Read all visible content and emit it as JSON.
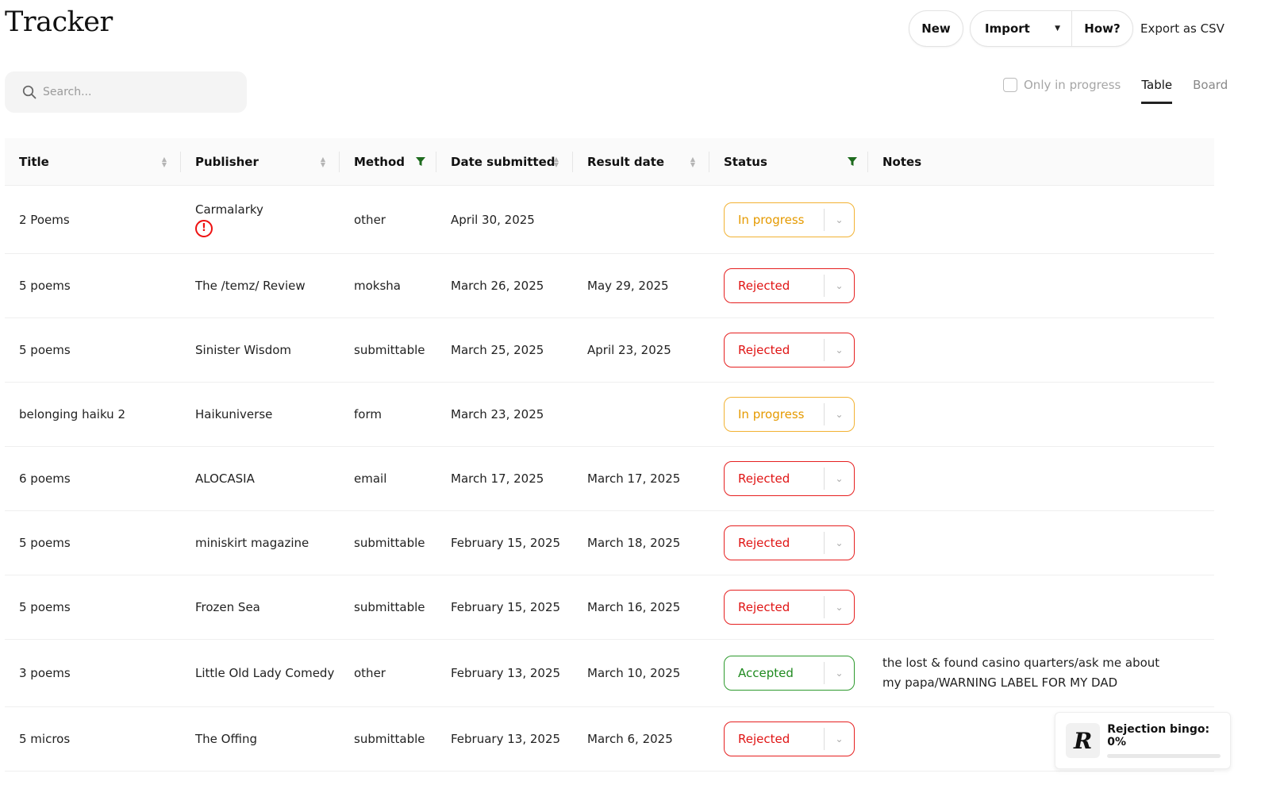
{
  "header": {
    "title": "Tracker"
  },
  "toolbar": {
    "new_label": "New",
    "import_label": "Import",
    "how_label": "How?",
    "export_label": "Export as CSV"
  },
  "search": {
    "placeholder": "Search...",
    "value": ""
  },
  "view": {
    "only_in_progress_label": "Only in progress",
    "only_in_progress_checked": false,
    "tabs": [
      "Table",
      "Board"
    ],
    "active_tab": "Table"
  },
  "table": {
    "columns": [
      "Title",
      "Publisher",
      "Method",
      "Date submitted",
      "Result date",
      "Status",
      "Notes"
    ],
    "rows": [
      {
        "title": "2 Poems",
        "publisher": "Carmalarky",
        "warning": "!",
        "method": "other",
        "date_submitted": "April 30, 2025",
        "result_date": "",
        "status": "In progress",
        "notes": ""
      },
      {
        "title": "5 poems",
        "publisher": "The /temz/ Review",
        "method": "moksha",
        "date_submitted": "March 26, 2025",
        "result_date": "May 29, 2025",
        "status": "Rejected",
        "notes": ""
      },
      {
        "title": "5 poems",
        "publisher": "Sinister Wisdom",
        "method": "submittable",
        "date_submitted": "March 25, 2025",
        "result_date": "April 23, 2025",
        "status": "Rejected",
        "notes": ""
      },
      {
        "title": "belonging haiku 2",
        "publisher": "Haikuniverse",
        "method": "form",
        "date_submitted": "March 23, 2025",
        "result_date": "",
        "status": "In progress",
        "notes": ""
      },
      {
        "title": "6 poems",
        "publisher": "ALOCASIA",
        "method": "email",
        "date_submitted": "March 17, 2025",
        "result_date": "March 17, 2025",
        "status": "Rejected",
        "notes": ""
      },
      {
        "title": "5 poems",
        "publisher": "miniskirt magazine",
        "method": "submittable",
        "date_submitted": "February 15, 2025",
        "result_date": "March 18, 2025",
        "status": "Rejected",
        "notes": ""
      },
      {
        "title": "5 poems",
        "publisher": "Frozen Sea",
        "method": "submittable",
        "date_submitted": "February 15, 2025",
        "result_date": "March 16, 2025",
        "status": "Rejected",
        "notes": ""
      },
      {
        "title": "3 poems",
        "publisher": "Little Old Lady Comedy",
        "method": "other",
        "date_submitted": "February 13, 2025",
        "result_date": "March 10, 2025",
        "status": "Accepted",
        "notes": "the lost & found casino quarters/ask me about my papa/WARNING LABEL FOR MY DAD"
      },
      {
        "title": "5 micros",
        "publisher": "The Offing",
        "method": "submittable",
        "date_submitted": "February 13, 2025",
        "result_date": "March 6, 2025",
        "status": "Rejected",
        "notes": ""
      }
    ]
  },
  "bingo": {
    "logo": "R",
    "label": "Rejection bingo: 0%",
    "progress": 0
  },
  "colors": {
    "in_progress": "#e59a00",
    "rejected": "#e01414",
    "accepted": "#1f8a1f",
    "filter_icon": "#1e6b1e"
  }
}
